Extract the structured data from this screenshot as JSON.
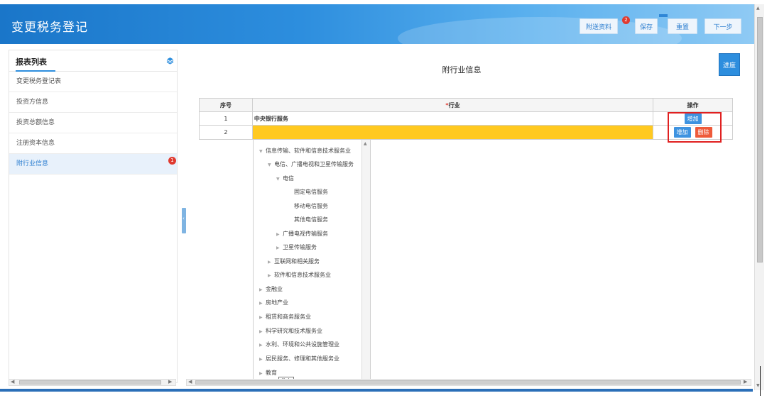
{
  "header": {
    "title": "变更税务登记",
    "buttons": {
      "attach": "附送资料",
      "save": "保存",
      "reset": "重置",
      "next": "下一步"
    },
    "attach_badge": "2"
  },
  "sidebar": {
    "title": "报表列表",
    "items": [
      {
        "label": "变更税务登记表"
      },
      {
        "label": "投资方信息"
      },
      {
        "label": "投资总额信息"
      },
      {
        "label": "注册资本信息"
      },
      {
        "label": "附行业信息",
        "badge": "1"
      }
    ]
  },
  "main": {
    "title": "附行业信息",
    "progress_button": "进度",
    "table": {
      "headers": {
        "seq": "序号",
        "industry_req": "*",
        "industry": "行业",
        "op": "操作"
      },
      "rows": [
        {
          "seq": "1",
          "industry": "中央银行服务",
          "ops": [
            "增加"
          ]
        },
        {
          "seq": "2",
          "industry": "",
          "ops": [
            "增加",
            "删除"
          ]
        }
      ]
    },
    "tree": {
      "nodes": [
        {
          "label": "信息传输、软件和信息技术服务业",
          "expander": "▼"
        },
        {
          "label": "电信、广播电视和卫星传输服务",
          "expander": "▼"
        },
        {
          "label": "电信",
          "expander": "▼"
        },
        {
          "label": "固定电信服务",
          "expander": ""
        },
        {
          "label": "移动电信服务",
          "expander": ""
        },
        {
          "label": "其他电信服务",
          "expander": ""
        },
        {
          "label": "广播电视传输服务",
          "expander": "▶"
        },
        {
          "label": "卫星传输服务",
          "expander": "▶"
        },
        {
          "label": "互联网和相关服务",
          "expander": "▶"
        },
        {
          "label": "软件和信息技术服务业",
          "expander": "▶"
        },
        {
          "label": "金融业",
          "expander": "▶"
        },
        {
          "label": "房地产业",
          "expander": "▶"
        },
        {
          "label": "租赁和商务服务业",
          "expander": "▶"
        },
        {
          "label": "科学研究和技术服务业",
          "expander": "▶"
        },
        {
          "label": "水利、环境和公共设施管理业",
          "expander": "▶"
        },
        {
          "label": "居民服务、修理和其他服务业",
          "expander": "▶"
        },
        {
          "label": "教育",
          "expander": "▶"
        }
      ],
      "tooltip": "教育"
    }
  },
  "colors": {
    "brand": "#2d8ede",
    "highlight": "#ffc920",
    "danger": "#ee5a3a",
    "badge": "#e03a2f"
  }
}
